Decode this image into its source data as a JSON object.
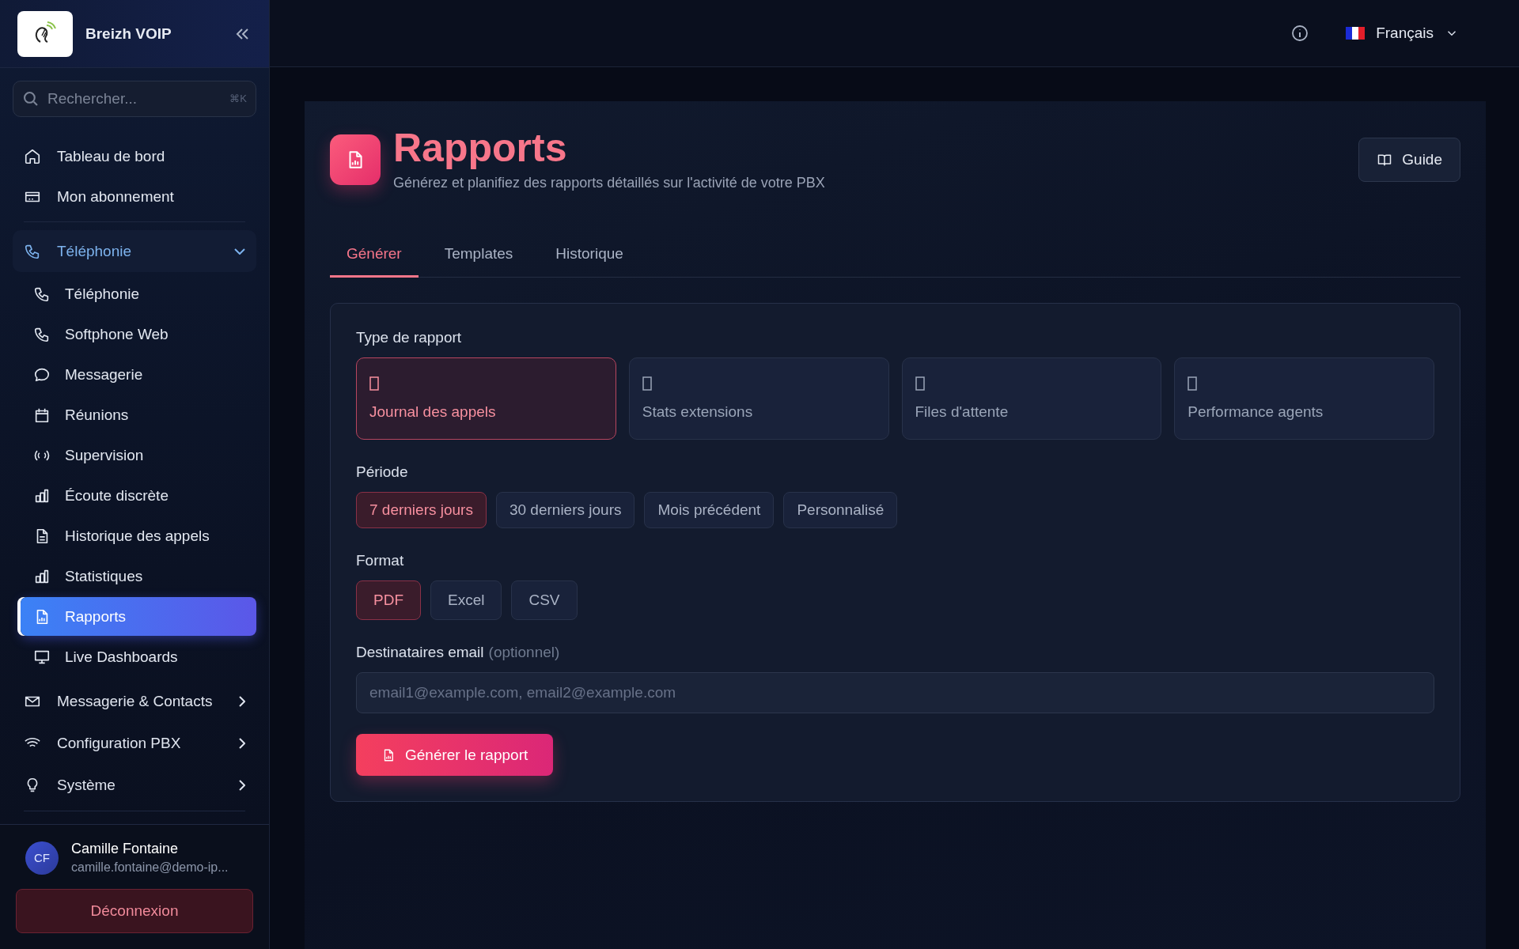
{
  "sidebar": {
    "brand": "Breizh VOIP",
    "search": {
      "placeholder": "Rechercher...",
      "shortcut": "⌘K"
    },
    "nav": [
      {
        "kind": "link",
        "label": "Tableau de bord",
        "selected": false
      },
      {
        "kind": "link",
        "label": "Mon abonnement",
        "selected": false
      },
      {
        "kind": "group",
        "label": "Téléphonie",
        "expanded": true,
        "children": [
          {
            "label": "Téléphonie",
            "selected": false
          },
          {
            "label": "Softphone Web",
            "selected": false
          },
          {
            "label": "Messagerie",
            "selected": false
          },
          {
            "label": "Réunions",
            "selected": false
          },
          {
            "label": "Supervision",
            "selected": false
          },
          {
            "label": "Écoute discrète",
            "selected": false
          },
          {
            "label": "Historique des appels",
            "selected": false
          },
          {
            "label": "Statistiques",
            "selected": false
          },
          {
            "label": "Rapports",
            "selected": true
          },
          {
            "label": "Live Dashboards",
            "selected": false
          }
        ]
      },
      {
        "kind": "group",
        "label": "Messagerie & Contacts",
        "expanded": false
      },
      {
        "kind": "group",
        "label": "Configuration PBX",
        "expanded": false
      },
      {
        "kind": "group",
        "label": "Système",
        "expanded": false
      }
    ],
    "user": {
      "initials": "CF",
      "name": "Camille Fontaine",
      "email": "camille.fontaine@demo-ip..."
    },
    "logout": "Déconnexion"
  },
  "topbar": {
    "language": "Français"
  },
  "page": {
    "title": "Rapports",
    "subtitle": "Générez et planifiez des rapports détaillés sur l'activité de votre PBX",
    "guide": "Guide",
    "tabs": [
      {
        "label": "Générer",
        "selected": true
      },
      {
        "label": "Templates",
        "selected": false
      },
      {
        "label": "Historique",
        "selected": false
      }
    ],
    "form": {
      "type_label": "Type de rapport",
      "types": [
        {
          "label": "Journal des appels",
          "selected": true
        },
        {
          "label": "Stats extensions",
          "selected": false
        },
        {
          "label": "Files d'attente",
          "selected": false
        },
        {
          "label": "Performance agents",
          "selected": false
        }
      ],
      "period_label": "Période",
      "periods": [
        {
          "label": "7 derniers jours",
          "selected": true
        },
        {
          "label": "30 derniers jours",
          "selected": false
        },
        {
          "label": "Mois précédent",
          "selected": false
        },
        {
          "label": "Personnalisé",
          "selected": false
        }
      ],
      "format_label": "Format",
      "formats": [
        {
          "label": "PDF",
          "selected": true
        },
        {
          "label": "Excel",
          "selected": false
        },
        {
          "label": "CSV",
          "selected": false
        }
      ],
      "email_label": "Destinataires email",
      "email_hint": "(optionnel)",
      "email_placeholder": "email1@example.com, email2@example.com",
      "submit": "Générer le rapport"
    }
  }
}
